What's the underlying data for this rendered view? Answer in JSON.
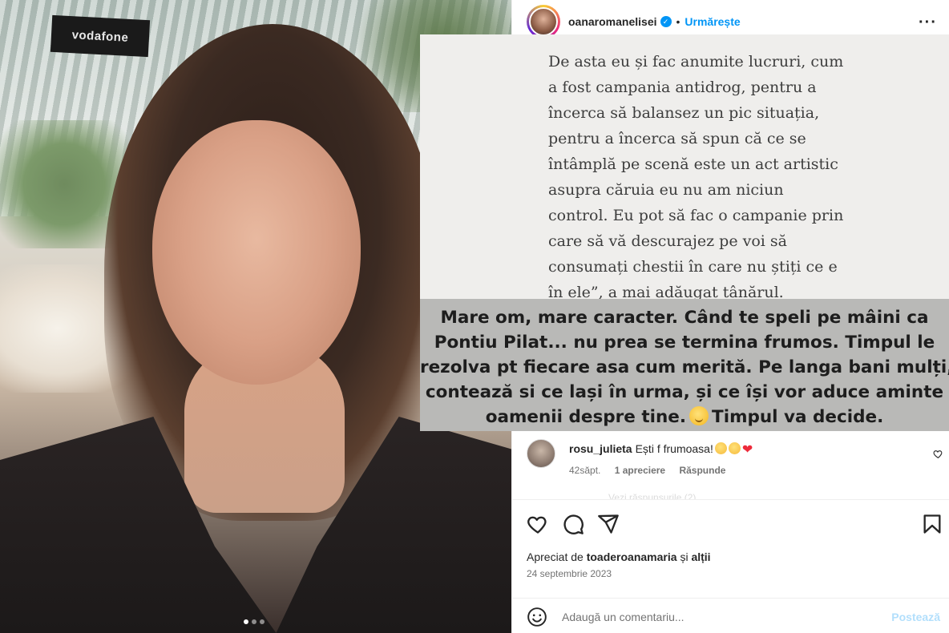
{
  "photo": {
    "sign_text": "vodafone",
    "carousel_dots": 3,
    "carousel_active_index": 0
  },
  "header": {
    "username": "oanaromanelisei",
    "verified": true,
    "separator": "•",
    "follow_label": "Urmărește",
    "more_icon": "more-horizontal-icon"
  },
  "story": {
    "quote_lines": [
      "De asta eu și fac anumite lucruri, cum",
      "a fost campania antidrog, pentru a",
      "încerca să balansez un pic situația,",
      "pentru a încerca să spun că ce se",
      "întâmplă pe scenă este un act artistic",
      "asupra căruia eu nu am niciun",
      "control. Eu pot să fac o campanie prin",
      "care să vă descurajez pe voi să",
      "consumați chestii în care nu știți ce e",
      "în ele”, a mai adăugat tânărul."
    ],
    "caption_lines": [
      "Mare om, mare caracter. Când te speli pe mâini ca",
      "Pontiu Pilat... nu prea se termina frumos. Timpul le",
      "rezolva pt fiecare asa cum merită. Pe langa bani mulți,",
      "contează si ce lași în urma, și ce își vor aduce aminte",
      "oamenii despre tine."
    ],
    "caption_tail": "Timpul va decide.",
    "colors": {
      "band": "#b9b9b7",
      "background": "#efeeec"
    }
  },
  "comment": {
    "username": "rosu_julieta",
    "text": "Ești f frumoasa!",
    "time": "42săpt.",
    "likes": "1 apreciere",
    "reply": "Răspunde",
    "faded_row": "Vezi răspunsurile (2)"
  },
  "actions": {
    "like_icon": "heart-icon",
    "comment_icon": "comment-icon",
    "share_icon": "share-icon",
    "save_icon": "bookmark-icon"
  },
  "likes": {
    "prefix": "Apreciat de",
    "user": "toaderoanamaria",
    "and": "și",
    "others": "alții"
  },
  "date": "24 septembrie 2023",
  "add_comment": {
    "placeholder": "Adaugă un comentariu...",
    "post_label": "Postează"
  },
  "colors": {
    "accent": "#0095f6",
    "heart": "#ed2b3b",
    "post_disabled": "#b2dffc"
  }
}
